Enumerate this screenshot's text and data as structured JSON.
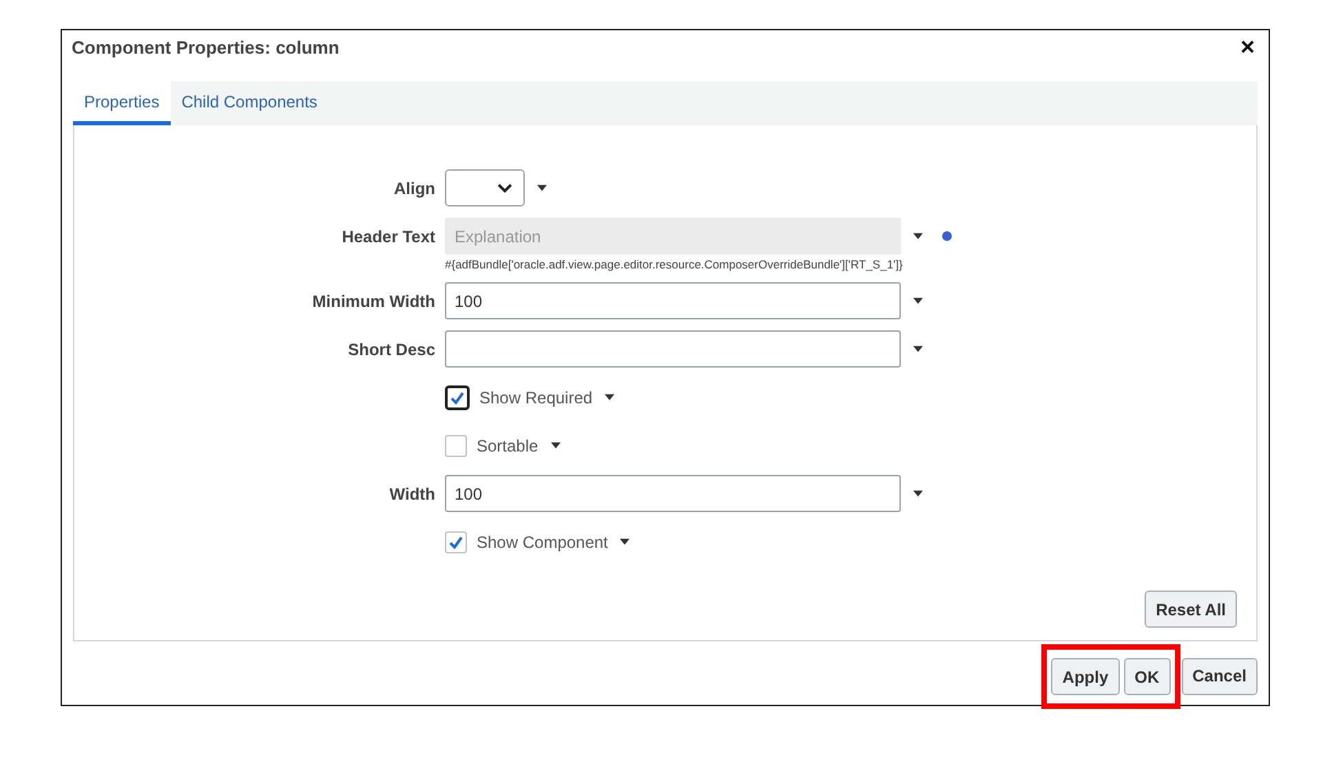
{
  "window": {
    "title": "Component Properties: column",
    "close": "×"
  },
  "tabs": [
    {
      "label": "Properties",
      "selected": true
    },
    {
      "label": "Child Components",
      "selected": false
    }
  ],
  "fields": [
    {
      "kind": "select",
      "label": "Align"
    },
    {
      "kind": "text",
      "label": "Header Text",
      "value": "Explanation",
      "disabled": true,
      "info": true,
      "hint": "#{adfBundle['oracle.adf.view.page.editor.resource.ComposerOverrideBundle']['RT_S_1']}"
    },
    {
      "kind": "text",
      "label": "Minimum Width",
      "value": "100",
      "disabled": false
    },
    {
      "kind": "text",
      "label": "Short Desc",
      "disabled": false
    },
    {
      "kind": "checkbox",
      "label": "Show Required",
      "checked": true,
      "focused": true
    },
    {
      "kind": "checkbox",
      "label": "Sortable",
      "checked": false,
      "focused": false
    },
    {
      "kind": "text",
      "label": "Width",
      "value": "100",
      "disabled": false
    },
    {
      "kind": "checkbox",
      "label": "Show Component",
      "checked": true,
      "focused": false
    }
  ],
  "reset_button": "Reset All",
  "buttons": [
    {
      "label": "Apply",
      "highlighted": true
    },
    {
      "label": "OK",
      "highlighted": true
    },
    {
      "label": "Cancel",
      "highlighted": false
    }
  ]
}
